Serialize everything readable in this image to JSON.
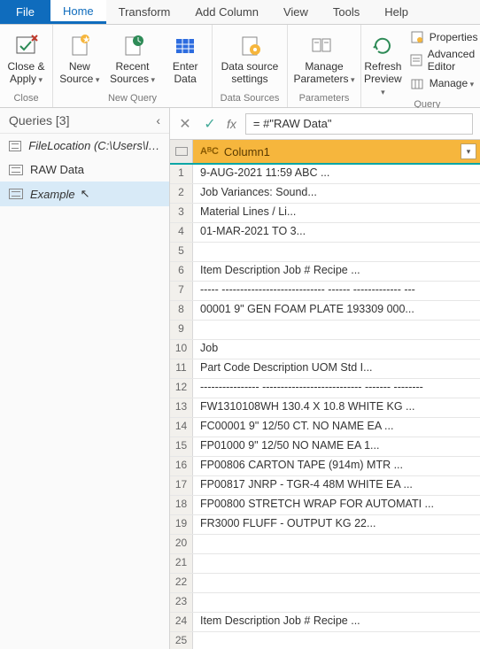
{
  "tabs": {
    "file": "File",
    "home": "Home",
    "transform": "Transform",
    "addColumn": "Add Column",
    "view": "View",
    "tools": "Tools",
    "help": "Help"
  },
  "ribbon": {
    "close": {
      "closeApply": "Close &\nApply",
      "group": "Close"
    },
    "newQuery": {
      "newSource": "New\nSource",
      "recentSources": "Recent\nSources",
      "enterData": "Enter\nData",
      "group": "New Query"
    },
    "dataSources": {
      "dataSourceSettings": "Data source\nsettings",
      "group": "Data Sources"
    },
    "parameters": {
      "manageParameters": "Manage\nParameters",
      "group": "Parameters"
    },
    "query": {
      "refreshPreview": "Refresh\nPreview",
      "properties": "Properties",
      "advancedEditor": "Advanced Editor",
      "manage": "Manage",
      "group": "Query"
    }
  },
  "sidebar": {
    "title": "Queries [3]",
    "items": [
      {
        "label": "FileLocation (C:\\Users\\lisde..."
      },
      {
        "label": "RAW Data"
      },
      {
        "label": "Example"
      }
    ]
  },
  "formula": {
    "text": "= #\"RAW Data\""
  },
  "grid": {
    "colType": "AᴮC",
    "colName": "Column1",
    "rows": [
      "9-AUG-2021 11:59                                        ABC ...",
      "                                              Job Variances: Sound...",
      "                                                Material Lines / Li...",
      "                                               01-MAR-2021 TO 3...",
      "",
      "Item       Description              Job #   Recipe             ...",
      "-----     ----------------------------        ------   -------------  ---",
      "00001     9\" GEN FOAM PLATE        193309 000...",
      "",
      "                                                 Job",
      "           Part Code   Description              UOM    Std I...",
      "           ----------------   ---------------------------  -------   --------",
      "           FW1310108WH  130.4 X 10.8        WHITE KG ...",
      "           FC00001     9\" 12/50 CT. NO NAME    EA     ...",
      "           FP01000     9\" 12/50 NO NAME          EA      1...",
      "           FP00806     CARTON TAPE (914m)     MTR   ...",
      "           FP00817     JNRP - TGR-4 48M WHITE   EA   ...",
      "           FP00800     STRETCH WRAP FOR AUTOMATI ...",
      "           FR3000       FLUFF - OUTPUT               KG      22...",
      "",
      "",
      "",
      "",
      "Item       Description              Job #   Recipe            ...",
      ""
    ]
  }
}
